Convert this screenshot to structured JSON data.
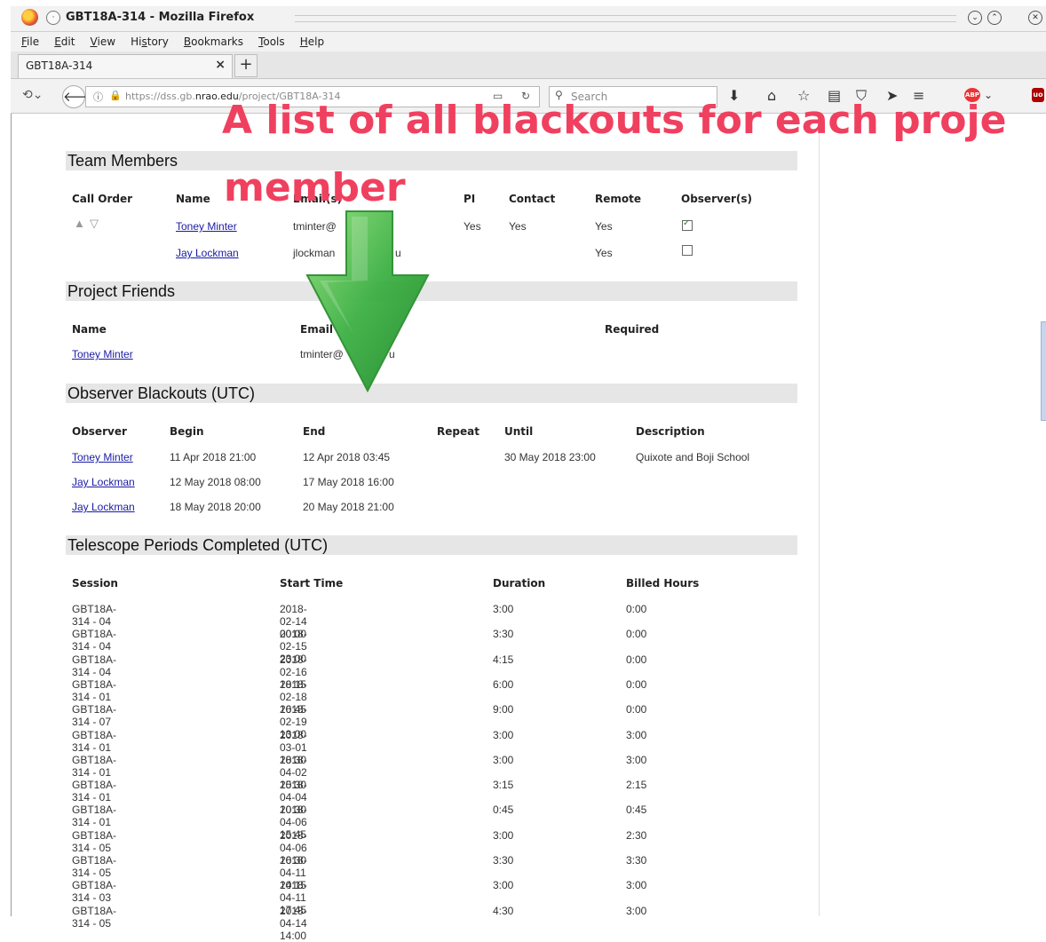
{
  "window": {
    "title": "GBT18A-314 - Mozilla Firefox"
  },
  "menu": [
    "File",
    "Edit",
    "View",
    "History",
    "Bookmarks",
    "Tools",
    "Help"
  ],
  "tab": {
    "label": "GBT18A-314",
    "close": "×",
    "new_tab": "+"
  },
  "urlbar": {
    "prefix": "https://dss.gb.",
    "domain": "nrao.edu",
    "path": "/project/GBT18A-314"
  },
  "search": {
    "placeholder": "Search"
  },
  "overlay": {
    "line1": "A list of all blackouts for each proje",
    "line2": "member"
  },
  "team": {
    "title": "Team Members",
    "headers": [
      "Call Order",
      "Name",
      "Email(s)",
      "PI",
      "Contact",
      "Remote",
      "Observer(s)"
    ],
    "rows": [
      {
        "name": "Toney Minter",
        "email": "tminter@",
        "pi": "Yes",
        "contact": "Yes",
        "remote": "Yes",
        "observer": true
      },
      {
        "name": "Jay Lockman",
        "email": "jlockman",
        "email_tail": "u",
        "pi": "",
        "contact": "",
        "remote": "Yes",
        "observer": false
      }
    ]
  },
  "friends": {
    "title": "Project Friends",
    "headers": [
      "Name",
      "Email",
      "Required"
    ],
    "rows": [
      {
        "name": "Toney Minter",
        "email": "tminter@",
        "email_tail": "u"
      }
    ]
  },
  "blackouts": {
    "title": "Observer Blackouts (UTC)",
    "headers": [
      "Observer",
      "Begin",
      "End",
      "Repeat",
      "Until",
      "Description"
    ],
    "rows": [
      {
        "observer": "Toney Minter",
        "begin": "11 Apr 2018 21:00",
        "end": "12 Apr 2018 03:45",
        "repeat": "",
        "until": "30 May 2018 23:00",
        "description": "Quixote and Boji School"
      },
      {
        "observer": "Jay Lockman",
        "begin": "12 May 2018 08:00",
        "end": "17 May 2018 16:00",
        "repeat": "",
        "until": "",
        "description": ""
      },
      {
        "observer": "Jay Lockman",
        "begin": "18 May 2018 20:00",
        "end": "20 May 2018 21:00",
        "repeat": "",
        "until": "",
        "description": ""
      }
    ]
  },
  "periods": {
    "title": "Telescope Periods Completed (UTC)",
    "headers": [
      "Session",
      "Start Time",
      "Duration",
      "Billed Hours"
    ],
    "rows": [
      [
        "GBT18A-314 - 04",
        "2018-02-14 00:00",
        "3:00",
        "0:00"
      ],
      [
        "GBT18A-314 - 04",
        "2018-02-15 23:00",
        "3:30",
        "0:00"
      ],
      [
        "GBT18A-314 - 04",
        "2018-02-16 18:15",
        "4:15",
        "0:00"
      ],
      [
        "GBT18A-314 - 01",
        "2018-02-18 16:45",
        "6:00",
        "0:00"
      ],
      [
        "GBT18A-314 - 07",
        "2018-02-19 13:00",
        "9:00",
        "0:00"
      ],
      [
        "GBT18A-314 - 01",
        "2018-03-01 18:30",
        "3:00",
        "3:00"
      ],
      [
        "GBT18A-314 - 01",
        "2018-04-02 15:30",
        "3:00",
        "3:00"
      ],
      [
        "GBT18A-314 - 01",
        "2018-04-04 10:30",
        "3:15",
        "2:15"
      ],
      [
        "GBT18A-314 - 01",
        "2018-04-06 15:45",
        "0:45",
        "0:45"
      ],
      [
        "GBT18A-314 - 05",
        "2018-04-06 16:30",
        "3:00",
        "2:30"
      ],
      [
        "GBT18A-314 - 05",
        "2018-04-11 14:15",
        "3:30",
        "3:30"
      ],
      [
        "GBT18A-314 - 03",
        "2018-04-11 17:45",
        "3:00",
        "3:00"
      ],
      [
        "GBT18A-314 - 05",
        "2018-04-14 14:00",
        "4:30",
        "3:00"
      ]
    ]
  },
  "colors": {
    "overlay_text": "#f0405f",
    "arrow": "#3cb043",
    "link": "#1a1aa6"
  }
}
